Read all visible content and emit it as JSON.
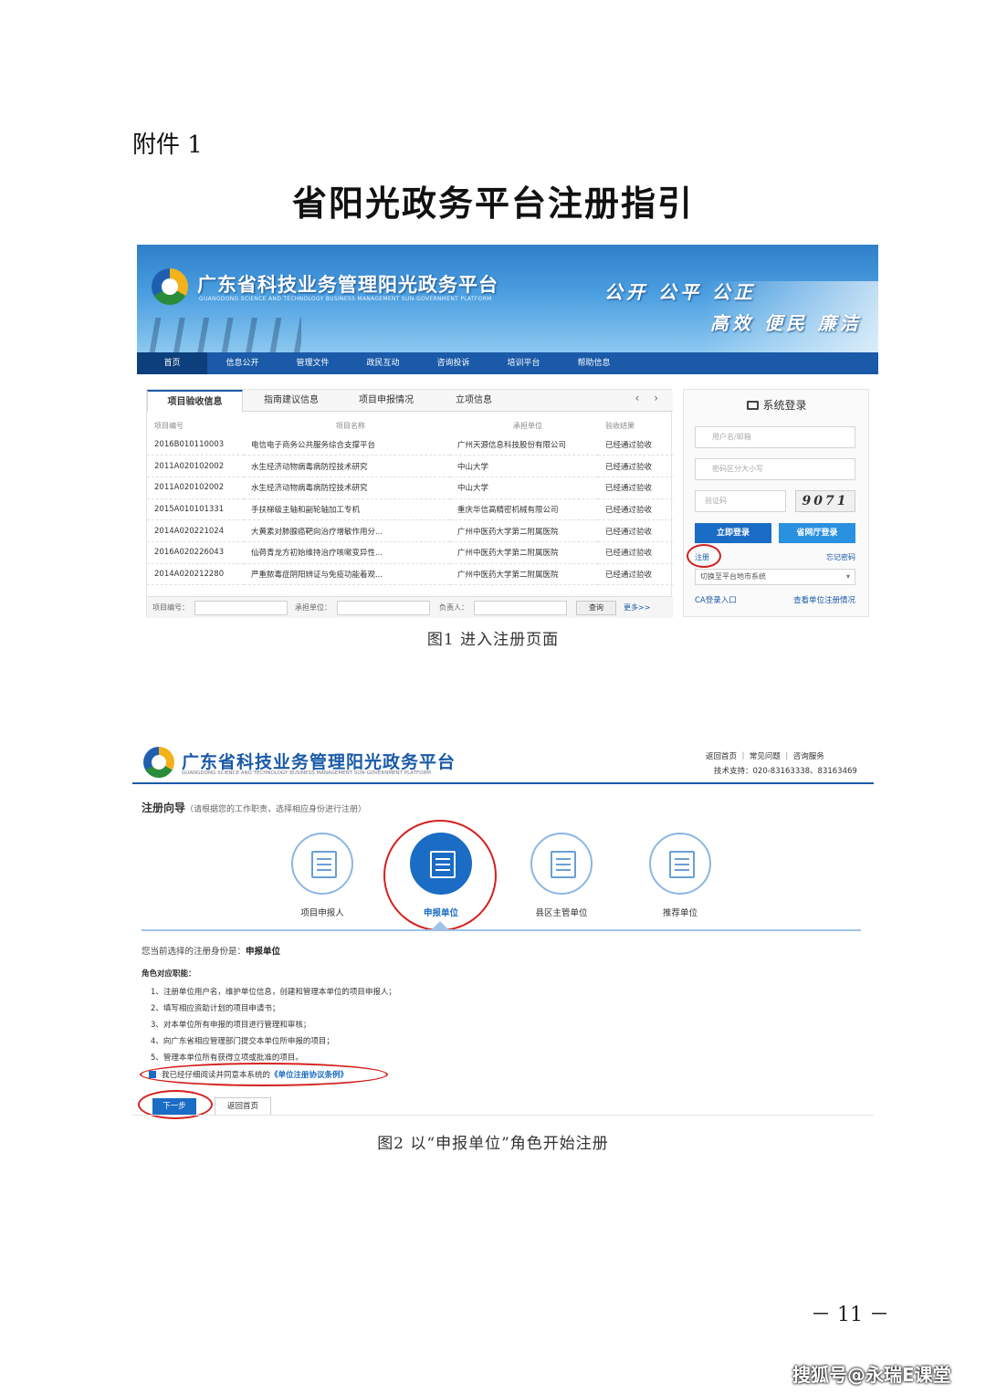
{
  "document": {
    "attachment_label": "附件 1",
    "title": "省阳光政务平台注册指引",
    "fig1_caption": "图1 进入注册页面",
    "fig2_caption": "图2 以“申报单位”角色开始注册",
    "page_number": "－ 11 －",
    "watermark": "搜狐号@永瑞E课堂"
  },
  "fig1": {
    "site_title": "广东省科技业务管理阳光政务平台",
    "site_subtitle": "GUANGDONG SCIENCE AND TECHNOLOGY BUSINESS MANAGEMENT SUN-GOVERNMENT PLATFORM",
    "slogan_1": "公开 公平 公正",
    "slogan_2": "高效 便民 廉洁",
    "nav": [
      "首页",
      "信息公开",
      "管理文件",
      "政民互动",
      "咨询投诉",
      "培训平台",
      "帮助信息"
    ],
    "tabs": [
      "项目验收信息",
      "指南建议信息",
      "项目申报情况",
      "立项信息"
    ],
    "tab_arrows": "‹ ›",
    "columns": [
      "项目编号",
      "项目名称",
      "承担单位",
      "验收结果"
    ],
    "rows": [
      [
        "2016B010110003",
        "电信电子商务公共服务综合支撑平台",
        "广州天源信息科技股份有限公司",
        "已经通过验收"
      ],
      [
        "2011A020102002",
        "水生经济动物病毒病防控技术研究",
        "中山大学",
        "已经通过验收"
      ],
      [
        "2011A020102002",
        "水生经济动物病毒病防控技术研究",
        "中山大学",
        "已经通过验收"
      ],
      [
        "2015A010101331",
        "手扶梯级主轴和副轮轴加工专机",
        "重庆华信高精密机械有限公司",
        "已经通过验收"
      ],
      [
        "2014A020221024",
        "大黄素对肺腺癌靶向治疗增敏作用分...",
        "广州中医药大学第二附属医院",
        "已经通过验收"
      ],
      [
        "2016A020226043",
        "仙荷青龙方初始维持治疗咳嗽变异性...",
        "广州中医药大学第二附属医院",
        "已经通过验收"
      ],
      [
        "2014A020212280",
        "严重脓毒症阴阳辨证与免疫功能着观...",
        "广州中医药大学第二附属医院",
        "已经通过验收"
      ]
    ],
    "search_labels": [
      "项目编号：",
      "承担单位：",
      "负责人："
    ],
    "search_button": "查询",
    "more_link": "更多>>",
    "login": {
      "title": "系统登录",
      "username_placeholder": "用户名/邮箱",
      "password_placeholder": "密码区分大小写",
      "captcha_placeholder": "验证码",
      "captcha_text": "9071",
      "login_button": "立即登录",
      "portal_login_button": "省网厅登录",
      "register_link": "注册",
      "forgot_link": "忘记密码",
      "city_select": "切换至平台地市系统",
      "ca_link": "CA登录入口",
      "view_reg_link": "查看单位注册情况"
    }
  },
  "fig2": {
    "site_title": "广东省科技业务管理阳光政务平台",
    "site_subtitle": "GUANGDONG SCIENCE AND TECHNOLOGY BUSINESS MANAGEMENT SUN-GOVERNMENT PLATFORM",
    "top_links": "返回首页 ｜ 常见问题 ｜ 咨询服务",
    "tech_support": "技术支持：020-83163338、83163469",
    "guide_title": "注册向导",
    "guide_hint": "（请根据您的工作职责，选择相应身份进行注册）",
    "roles": [
      "项目申报人",
      "申报单位",
      "县区主管单位",
      "推荐单位"
    ],
    "current_label": "您当前选择的注册身份是：",
    "current_role": "申报单位",
    "duties_title": "角色对应职能：",
    "duties": [
      "1、注册单位用户名，维护单位信息，创建和管理本单位的项目申报人；",
      "2、填写相应资助计划的项目申请书；",
      "3、对本单位所有申报的项目进行管理和审核；",
      "4、向广东省相应管理部门提交本单位所申报的项目；",
      "5、管理本单位所有获得立项或批准的项目。"
    ],
    "agree_text": "我已经仔细阅读并同意本系统的",
    "agree_link": "《单位注册协议条例》",
    "next_button": "下一步",
    "back_button": "返回首页"
  }
}
